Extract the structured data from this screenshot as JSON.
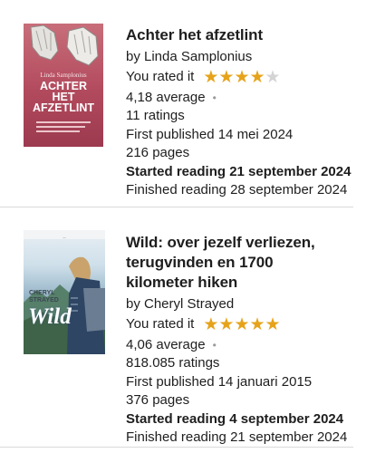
{
  "books": [
    {
      "title": "Achter het afzetlint",
      "author": "by Linda Samplonius",
      "rated_label": "You rated it",
      "rating": 4,
      "average": "4,18 average",
      "ratings": "11 ratings",
      "published": "First published 14 mei 2024",
      "pages": "216 pages",
      "started": "Started reading 21 september 2024",
      "finished": "Finished reading 28 september 2024",
      "cover": {
        "author": "Linda Samplonius",
        "title_lines": [
          "ACHTER",
          "HET",
          "AFZETLINT"
        ]
      }
    },
    {
      "title": "Wild: over jezelf verliezen, terugvinden en 1700 kilometer hiken",
      "author": "by Cheryl Strayed",
      "rated_label": "You rated it",
      "rating": 5,
      "average": "4,06 average",
      "ratings": "818.085 ratings",
      "published": "First published 14 januari 2015",
      "pages": "376 pages",
      "started": "Started reading 4 september 2024",
      "finished": "Finished reading 21 september 2024",
      "cover": {
        "author_lines": [
          "CHERYL",
          "STRAYED"
        ],
        "title": "Wild"
      }
    }
  ],
  "colors": {
    "star_on": "#e6a31a",
    "star_off": "#d4d4d4",
    "divider": "#dadada"
  }
}
